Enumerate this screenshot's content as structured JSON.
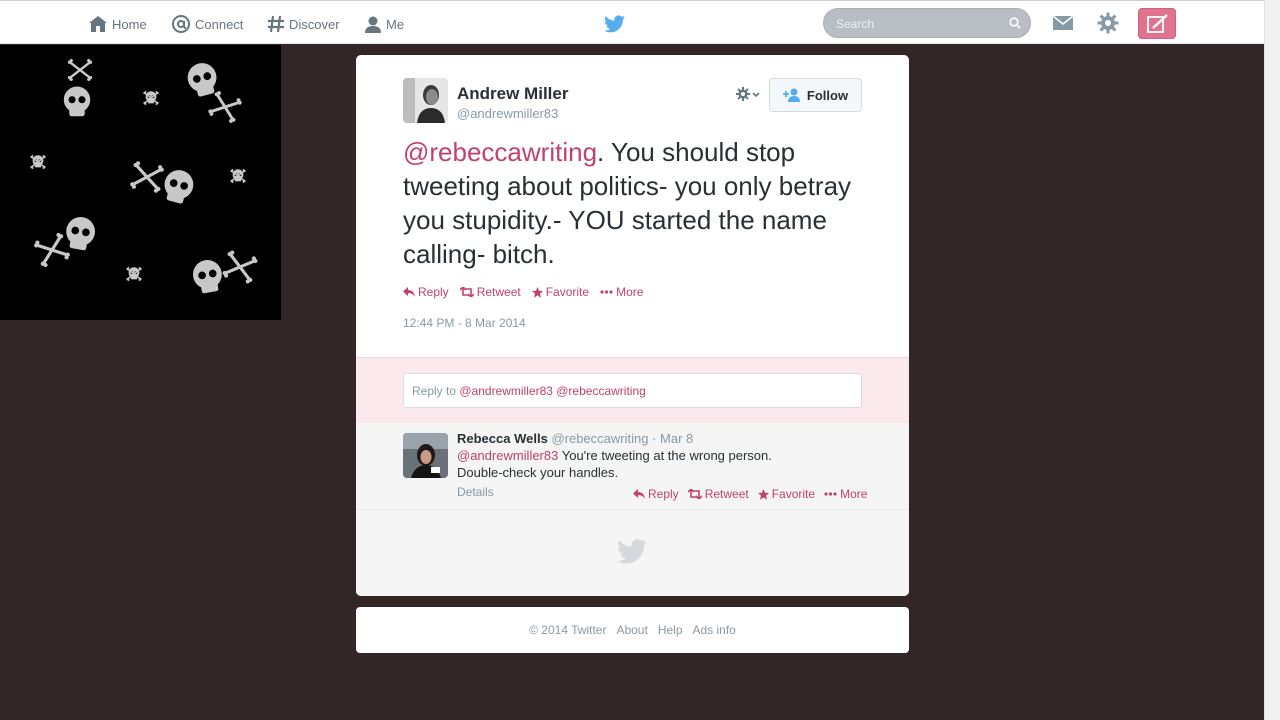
{
  "nav": {
    "home": "Home",
    "connect": "Connect",
    "discover": "Discover",
    "me": "Me",
    "search_placeholder": "Search"
  },
  "tweet": {
    "fullname": "Andrew Miller",
    "handle": "@andrewmiller83",
    "follow_label": "Follow",
    "mention": "@rebeccawriting",
    "text": ". You should stop tweeting about politics- you only betray you stupidity.- YOU started the name calling- bitch.",
    "actions": {
      "reply": "Reply",
      "retweet": "Retweet",
      "favorite": "Favorite",
      "more": "More"
    },
    "timestamp": "12:44 PM - 8 Mar 2014"
  },
  "reply_box": {
    "prefix": "Reply to ",
    "mentions": "@andrewmiller83 @rebeccawriting"
  },
  "reply_tweet": {
    "fullname": "Rebecca Wells",
    "handle": "@rebeccawriting",
    "date": "· Mar 8",
    "mention": "@andrewmiller83",
    "text_line1": " You're tweeting at the wrong person.",
    "text_line2": "Double-check your handles.",
    "details": "Details",
    "actions": {
      "reply": "Reply",
      "retweet": "Retweet",
      "favorite": "Favorite",
      "more": "More"
    }
  },
  "footer": {
    "copyright": "© 2014 Twitter",
    "about": "About",
    "help": "Help",
    "ads": "Ads info"
  },
  "colors": {
    "accent": "#c2426b",
    "background": "#332627",
    "compose": "#e0738f",
    "twitter_blue": "#55acee"
  }
}
